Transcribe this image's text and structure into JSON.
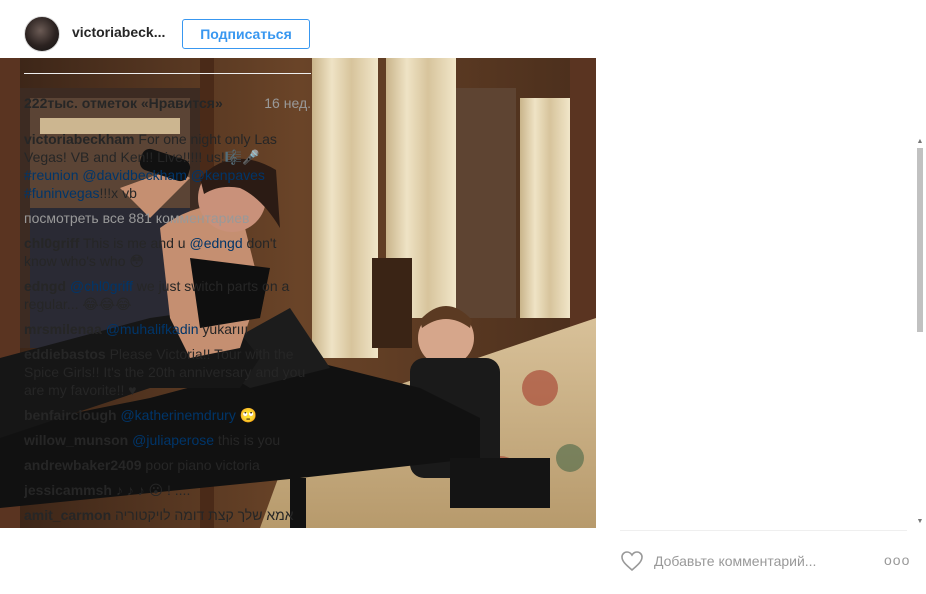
{
  "post": {
    "username": "victoriabeck...",
    "follow_label": "Подписаться",
    "likes": "222тыс. отметок «Нравится»",
    "age": "16 нед.",
    "caption": {
      "author": "victoriabeckham",
      "text": " For one night only Las Vegas! VB and Ken!! Live!!!!! us!🎼🎤 ",
      "tags": "#reunion @davidbeckham @kenpaves #funinvegas",
      "tail": "!!!x vb"
    },
    "view_all": "посмотреть все 881 комментариев",
    "comments": [
      {
        "author": "chl0griff",
        "tag": "",
        "text": " This is me and u ",
        "tag2": "@edngd",
        "text2": " don't know who's who 😳"
      },
      {
        "author": "edngd",
        "tag": " @chl0griff",
        "text": " we just switch parts on a regular... 😂😂😂",
        "tag2": "",
        "text2": ""
      },
      {
        "author": "mrsmilenaa",
        "tag": " @muhalifkadin",
        "text": " yukarııı",
        "tag2": "",
        "text2": ""
      },
      {
        "author": "eddiebastos",
        "tag": "",
        "text": " Please Victoria!! Tour with the Spice Girls!! It's the 20th anniversary and you are my favorite!! ♥",
        "tag2": "",
        "text2": ""
      },
      {
        "author": "benfairclough",
        "tag": " @katherinemdrury",
        "text": " 🙄",
        "tag2": "",
        "text2": ""
      },
      {
        "author": "willow_munson",
        "tag": " @juliaperose",
        "text": " this is you",
        "tag2": "",
        "text2": ""
      },
      {
        "author": "andrewbaker2409",
        "tag": "",
        "text": " poor piano victoria",
        "tag2": "",
        "text2": ""
      },
      {
        "author": "jessicammsh",
        "tag": "",
        "text": " ♪ ♪ ♪ 😮 ! ....",
        "tag2": "",
        "text2": ""
      },
      {
        "author": "amit_carmon",
        "tag": "",
        "text": " אמא שלך קצת דומה לויקטוריה",
        "tag2": "",
        "text2": ""
      }
    ]
  },
  "footer": {
    "comment_placeholder": "Добавьте комментарий...",
    "more_label": "ooo"
  },
  "icons": {
    "like": "heart-icon",
    "more": "more-options-icon"
  },
  "colors": {
    "accent": "#3897f0",
    "tag": "#003569",
    "muted": "#999999"
  }
}
